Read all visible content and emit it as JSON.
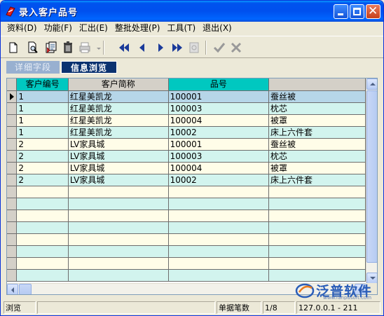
{
  "window": {
    "title": "录入客户品号"
  },
  "menu": {
    "items": [
      "资料(D)",
      "功能(F)",
      "汇出(E)",
      "整批处理(P)",
      "工具(T)",
      "退出(X)"
    ]
  },
  "toolbar": {
    "buttons": [
      "new-doc",
      "print-preview",
      "export",
      "delete",
      "print",
      "first",
      "prev",
      "next",
      "last",
      "lock",
      "confirm",
      "cancel"
    ]
  },
  "tabs": {
    "detail": "详细字段",
    "browse": "信息浏览"
  },
  "table": {
    "columns": [
      "客户编号",
      "客户简称",
      "品号",
      ""
    ],
    "rows": [
      [
        "1",
        "红星美凯龙",
        "100001",
        "蚕丝被"
      ],
      [
        "1",
        "红星美凯龙",
        "100003",
        "枕芯"
      ],
      [
        "1",
        "红星美凯龙",
        "100004",
        "被罩"
      ],
      [
        "1",
        "红星美凯龙",
        "10002",
        "床上六件套"
      ],
      [
        "2",
        "LV家具城",
        "100001",
        "蚕丝被"
      ],
      [
        "2",
        "LV家具城",
        "100003",
        "枕芯"
      ],
      [
        "2",
        "LV家具城",
        "100004",
        "被罩"
      ],
      [
        "2",
        "LV家具城",
        "10002",
        "床上六件套"
      ]
    ],
    "selected_row": 0
  },
  "watermark": {
    "brand": "泛普软件",
    "url": "www.fanpusoft.com"
  },
  "status": {
    "mode": "浏览",
    "blank1": "",
    "record_label": "单据笔数",
    "record_pos": "1/8",
    "server": "127.0.0.1 - 211"
  },
  "colors": {
    "titlebar": "#0053ee",
    "header_highlight": "#00c8c0",
    "row_even": "#fffde8",
    "row_odd": "#d2f4ee",
    "row_selected": "#b6d6e8"
  }
}
